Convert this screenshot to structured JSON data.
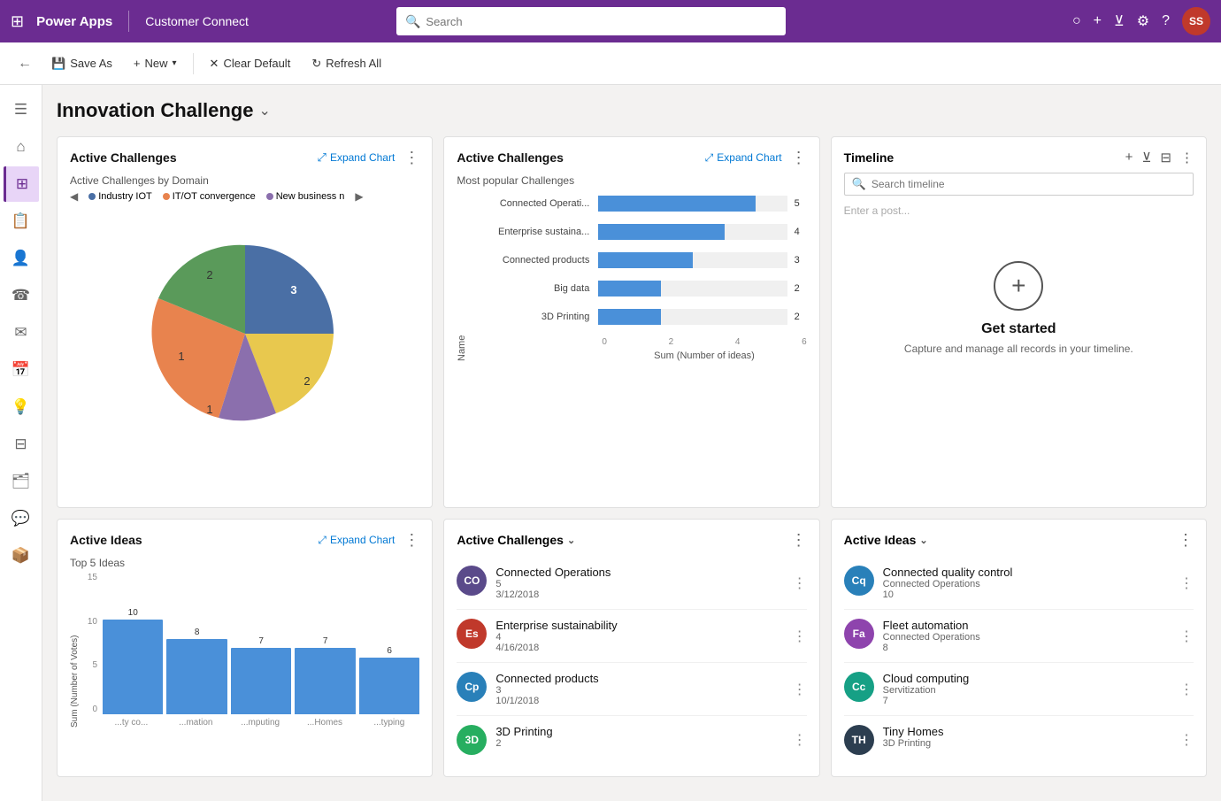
{
  "topbar": {
    "app_name": "Power Apps",
    "site_name": "Customer Connect",
    "search_placeholder": "Search",
    "avatar_initials": "SS"
  },
  "toolbar": {
    "save_as_label": "Save As",
    "new_label": "New",
    "clear_default_label": "Clear Default",
    "refresh_all_label": "Refresh All"
  },
  "page": {
    "title": "Innovation Challenge",
    "chart1": {
      "title": "Active Challenges",
      "expand_label": "Expand Chart",
      "subtitle": "Active Challenges by Domain",
      "legend": [
        {
          "label": "Industry IOT",
          "color": "#4a6fa5"
        },
        {
          "label": "IT/OT convergence",
          "color": "#e8834e"
        },
        {
          "label": "New business n",
          "color": "#8b6fad"
        }
      ],
      "slices": [
        {
          "value": 3,
          "color": "#4a6fa5",
          "angle": 110
        },
        {
          "value": 2,
          "color": "#e8c84e",
          "angle": 70
        },
        {
          "value": 1,
          "color": "#8b6fad",
          "angle": 40
        },
        {
          "value": 2,
          "color": "#e8834e",
          "angle": 80
        },
        {
          "value": 1,
          "color": "#5a9a5a",
          "angle": 60
        }
      ],
      "labels": [
        "1",
        "2",
        "3",
        "1",
        "2"
      ]
    },
    "chart2": {
      "title": "Active Challenges",
      "expand_label": "Expand Chart",
      "subtitle": "Most popular Challenges",
      "y_axis_label": "Name",
      "x_axis_label": "Sum (Number of ideas)",
      "bars": [
        {
          "label": "Connected Operati...",
          "value": 5,
          "max": 6
        },
        {
          "label": "Enterprise sustaina...",
          "value": 4,
          "max": 6
        },
        {
          "label": "Connected products",
          "value": 3,
          "max": 6
        },
        {
          "label": "Big data",
          "value": 2,
          "max": 6
        },
        {
          "label": "3D Printing",
          "value": 2,
          "max": 6
        }
      ],
      "x_ticks": [
        "0",
        "2",
        "4",
        "6"
      ]
    },
    "timeline": {
      "title": "Timeline",
      "search_placeholder": "Search timeline",
      "post_placeholder": "Enter a post...",
      "empty_title": "Get started",
      "empty_sub": "Capture and manage all records in your timeline."
    },
    "chart3": {
      "title": "Active Ideas",
      "expand_label": "Expand Chart",
      "subtitle": "Top 5 Ideas",
      "y_axis_label": "Sum (Number of Votes)",
      "bars": [
        {
          "label": "...ty co...",
          "value": 10,
          "height_pct": 67
        },
        {
          "label": "...mation",
          "value": 8,
          "height_pct": 53
        },
        {
          "label": "...mputing",
          "value": 7,
          "height_pct": 47
        },
        {
          "label": "...Homes",
          "value": 7,
          "height_pct": 47
        },
        {
          "label": "...typing",
          "value": 6,
          "height_pct": 40
        }
      ],
      "y_ticks": [
        "0",
        "5",
        "10",
        "15"
      ]
    },
    "list1": {
      "title": "Active Challenges",
      "items": [
        {
          "initials": "CO",
          "color": "#5a4a8a",
          "title": "Connected Operations",
          "sub1": "5",
          "sub2": "3/12/2018"
        },
        {
          "initials": "Es",
          "color": "#c0392b",
          "title": "Enterprise sustainability",
          "sub1": "4",
          "sub2": "4/16/2018"
        },
        {
          "initials": "Cp",
          "color": "#2980b9",
          "title": "Connected products",
          "sub1": "3",
          "sub2": "10/1/2018"
        },
        {
          "initials": "3D",
          "color": "#27ae60",
          "title": "3D Printing",
          "sub1": "2",
          "sub2": ""
        }
      ]
    },
    "list2": {
      "title": "Active Ideas",
      "items": [
        {
          "initials": "Cq",
          "color": "#2980b9",
          "title": "Connected quality control",
          "sub1": "Connected Operations",
          "sub2": "10"
        },
        {
          "initials": "Fa",
          "color": "#8e44ad",
          "title": "Fleet automation",
          "sub1": "Connected Operations",
          "sub2": "8"
        },
        {
          "initials": "Cc",
          "color": "#16a085",
          "title": "Cloud computing",
          "sub1": "Servitization",
          "sub2": "7"
        },
        {
          "initials": "TH",
          "color": "#2c3e50",
          "title": "Tiny Homes",
          "sub1": "3D Printing",
          "sub2": ""
        }
      ]
    }
  },
  "sidebar": {
    "items": [
      {
        "icon": "☰",
        "name": "menu"
      },
      {
        "icon": "⌂",
        "name": "home"
      },
      {
        "icon": "⊞",
        "name": "dashboard",
        "active": true
      },
      {
        "icon": "📄",
        "name": "records"
      },
      {
        "icon": "👤",
        "name": "contacts"
      },
      {
        "icon": "☎",
        "name": "calls"
      },
      {
        "icon": "✉",
        "name": "email"
      },
      {
        "icon": "📅",
        "name": "calendar"
      },
      {
        "icon": "💡",
        "name": "ideas"
      },
      {
        "icon": "📦",
        "name": "products"
      },
      {
        "icon": "🗂",
        "name": "categories"
      },
      {
        "icon": "💬",
        "name": "messages"
      },
      {
        "icon": "📦",
        "name": "packages"
      }
    ]
  }
}
